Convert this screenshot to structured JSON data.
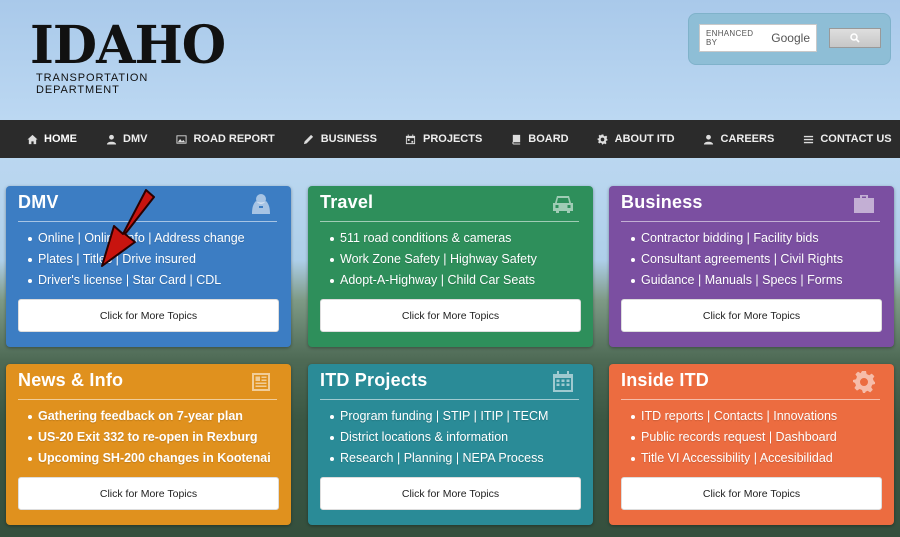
{
  "header": {
    "logo_word": "IDAHO",
    "logo_sub": "TRANSPORTATION DEPARTMENT",
    "search": {
      "enhanced_label": "ENHANCED BY",
      "google_label": "Google",
      "button_icon": "search-icon"
    }
  },
  "nav": {
    "items": [
      {
        "label": "HOME",
        "icon": "home-icon"
      },
      {
        "label": "DMV",
        "icon": "user-icon"
      },
      {
        "label": "ROAD REPORT",
        "icon": "picture-icon"
      },
      {
        "label": "BUSINESS",
        "icon": "pencil-icon"
      },
      {
        "label": "PROJECTS",
        "icon": "calendar-icon"
      },
      {
        "label": "BOARD",
        "icon": "book-icon"
      },
      {
        "label": "ABOUT ITD",
        "icon": "gear-icon"
      },
      {
        "label": "CAREERS",
        "icon": "user-icon"
      },
      {
        "label": "CONTACT US",
        "icon": "list-icon"
      }
    ]
  },
  "cards": {
    "dmv": {
      "title": "DMV",
      "icon": "person-icon",
      "items": [
        "Online | Online Info | Address change",
        "Plates | Titles | Drive insured",
        "Driver's license | Star Card | CDL"
      ],
      "button": "Click for More Topics"
    },
    "travel": {
      "title": "Travel",
      "icon": "car-icon",
      "items": [
        "511 road conditions & cameras",
        "Work Zone Safety | Highway Safety",
        "Adopt-A-Highway | Child Car Seats"
      ],
      "button": "Click for More Topics"
    },
    "business": {
      "title": "Business",
      "icon": "briefcase-icon",
      "items": [
        "Contractor bidding | Facility bids",
        "Consultant agreements | Civil Rights",
        "Guidance | Manuals | Specs | Forms"
      ],
      "button": "Click for More Topics"
    },
    "news": {
      "title": "News & Info",
      "icon": "newspaper-icon",
      "items": [
        "Gathering feedback on 7-year plan",
        "US-20 Exit 332 to re-open in Rexburg",
        "Upcoming SH-200 changes in Kootenai"
      ],
      "button": "Click for More Topics"
    },
    "projects": {
      "title": "ITD Projects",
      "icon": "calendar-icon",
      "items": [
        "Program funding | STIP | ITIP | TECM",
        "District locations & information",
        "Research | Planning | NEPA Process"
      ],
      "button": "Click for More Topics"
    },
    "inside": {
      "title": "Inside ITD",
      "icon": "gear-icon",
      "items": [
        "ITD reports | Contacts | Innovations",
        "Public records request | Dashboard",
        "Title VI Accessibility | Accesibilidad"
      ],
      "button": "Click for More Topics"
    }
  },
  "colors": {
    "nav_bg": "#2b2b2b",
    "dmv": "#3c7dc3",
    "travel": "#2e8f5b",
    "business": "#7b4fa1",
    "news": "#e0911e",
    "projects": "#2a8b97",
    "inside": "#ec6c40",
    "annotation_arrow": "#c8140f"
  }
}
